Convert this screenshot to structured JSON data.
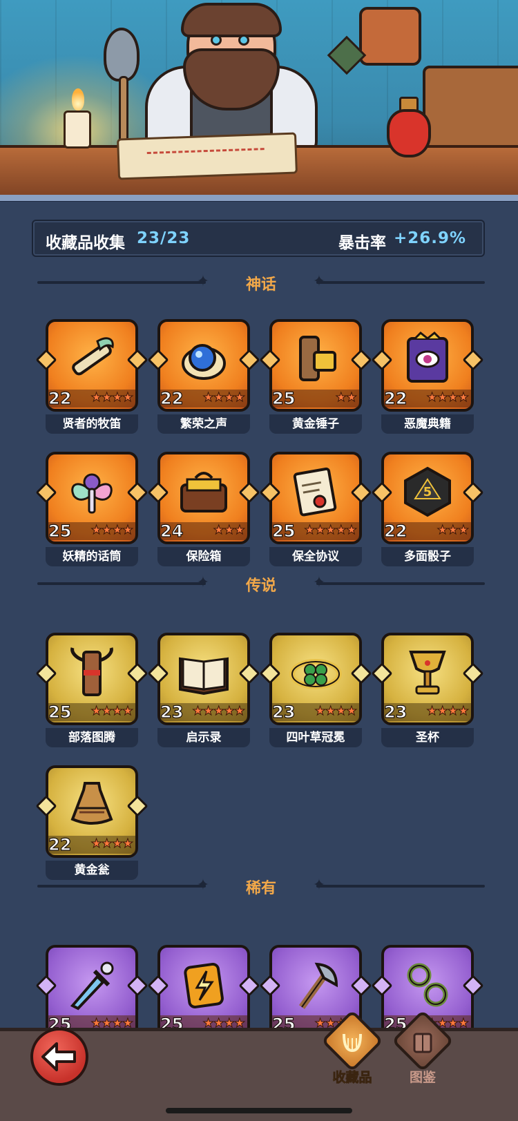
{
  "stats": {
    "collection_label": "收藏品收集",
    "collection_value": "23/23",
    "crit_label": "暴击率",
    "crit_value": "+26.9%"
  },
  "sections": {
    "mythic": {
      "title": "神话",
      "items": [
        {
          "name": "贤者的牧笛",
          "level": "22",
          "stars": "★★★★",
          "icon": "flute-icon"
        },
        {
          "name": "繁荣之声",
          "level": "22",
          "stars": "★★★★",
          "icon": "conch-orb-icon"
        },
        {
          "name": "黄金锤子",
          "level": "25",
          "stars": "★★",
          "icon": "golden-hammer-icon"
        },
        {
          "name": "恶魔典籍",
          "level": "22",
          "stars": "★★★★",
          "icon": "demon-tome-icon"
        },
        {
          "name": "妖精的话筒",
          "level": "25",
          "stars": "★★★★",
          "icon": "fairy-microphone-icon"
        },
        {
          "name": "保险箱",
          "level": "24",
          "stars": "★★★",
          "icon": "gold-chest-icon"
        },
        {
          "name": "保全协议",
          "level": "25",
          "stars": "★★★★★",
          "icon": "contract-scroll-icon"
        },
        {
          "name": "多面骰子",
          "level": "22",
          "stars": "★★★",
          "icon": "d20-dice-icon"
        }
      ]
    },
    "legendary": {
      "title": "传说",
      "items": [
        {
          "name": "部落图腾",
          "level": "25",
          "stars": "★★★★",
          "icon": "tribal-totem-icon"
        },
        {
          "name": "启示录",
          "level": "23",
          "stars": "★★★★★",
          "icon": "open-book-icon"
        },
        {
          "name": "四叶草冠冕",
          "level": "23",
          "stars": "★★★★",
          "icon": "clover-crown-icon"
        },
        {
          "name": "圣杯",
          "level": "23",
          "stars": "★★★★",
          "icon": "holy-grail-icon"
        },
        {
          "name": "黄金瓮",
          "level": "22",
          "stars": "★★★★",
          "icon": "golden-urn-icon"
        }
      ]
    },
    "rare": {
      "title": "稀有",
      "items": [
        {
          "name": "",
          "level": "25",
          "stars": "★★★★",
          "icon": "frost-dagger-icon"
        },
        {
          "name": "",
          "level": "25",
          "stars": "★★★★",
          "icon": "thunder-rune-icon"
        },
        {
          "name": "",
          "level": "25",
          "stars": "★★★★",
          "icon": "battle-axe-icon"
        },
        {
          "name": "",
          "level": "25",
          "stars": "★★★★",
          "icon": "thorn-vine-icon"
        }
      ]
    }
  },
  "nav": {
    "collection_label": "收藏品",
    "codex_label": "图鉴"
  },
  "colors": {
    "mythic": "#f0801f",
    "legendary": "#d6b240",
    "rare": "#9560d0",
    "accent_value": "#7fd3ff",
    "section_title": "#f2a849"
  }
}
